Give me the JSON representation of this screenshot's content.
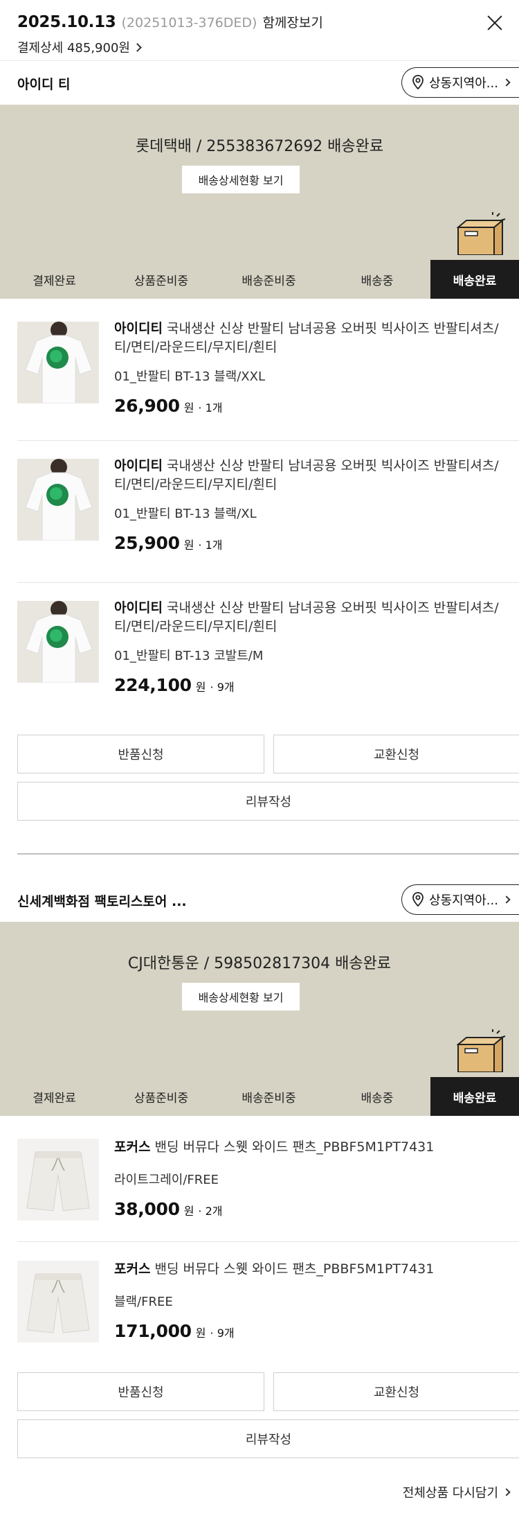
{
  "header": {
    "date": "2025.10.13",
    "order_code": "(20251013-376DED)",
    "together_link": "함께장보기",
    "payment_detail": "결제상세 485,900원"
  },
  "orders": [
    {
      "store": "아이디 티",
      "location_button": "상동지역아...",
      "carrier_status": "롯데택배 / 255383672692 배송완료",
      "tracking_button": "배송상세현황 보기",
      "steps": [
        "결제완료",
        "상품준비중",
        "배송준비중",
        "배송중",
        "배송완료"
      ],
      "active_step": "배송완료",
      "items": [
        {
          "brand": "아이디티",
          "name": " 국내생산 신상 반팔티 남녀공용 오버핏 빅사이즈 반팔티셔츠/티/면티/라운드티/무지티/흰티",
          "option": "01_반팔티 BT-13 블랙/XXL",
          "price": "26,900",
          "won": "원",
          "qty": "· 1개"
        },
        {
          "brand": "아이디티",
          "name": " 국내생산 신상 반팔티 남녀공용 오버핏 빅사이즈 반팔티셔츠/티/면티/라운드티/무지티/흰티",
          "option": "01_반팔티 BT-13 블랙/XL",
          "price": "25,900",
          "won": "원",
          "qty": "· 1개"
        },
        {
          "brand": "아이디티",
          "name": " 국내생산 신상 반팔티 남녀공용 오버핏 빅사이즈 반팔티셔츠/티/면티/라운드티/무지티/흰티",
          "option": "01_반팔티 BT-13 코발트/M",
          "price": "224,100",
          "won": "원",
          "qty": "· 9개"
        }
      ],
      "return_button": "반품신청",
      "exchange_button": "교환신청",
      "review_button": "리뷰작성"
    },
    {
      "store": "신세계백화점 팩토리스토어 ...",
      "location_button": "상동지역아...",
      "carrier_status": "CJ대한통운 / 598502817304 배송완료",
      "tracking_button": "배송상세현황 보기",
      "steps": [
        "결제완료",
        "상품준비중",
        "배송준비중",
        "배송중",
        "배송완료"
      ],
      "active_step": "배송완료",
      "items": [
        {
          "brand": "포커스",
          "name": " 밴딩 버뮤다 스웻 와이드 팬츠_PBBF5M1PT7431",
          "option": "라이트그레이/FREE",
          "price": "38,000",
          "won": "원",
          "qty": "· 2개"
        },
        {
          "brand": "포커스",
          "name": " 밴딩 버뮤다 스웻 와이드 팬츠_PBBF5M1PT7431",
          "option": "블랙/FREE",
          "price": "171,000",
          "won": "원",
          "qty": "· 9개"
        }
      ],
      "return_button": "반품신청",
      "exchange_button": "교환신청",
      "review_button": "리뷰작성"
    }
  ],
  "footer": {
    "reorder_all": "전체상품 다시담기"
  },
  "colors": {
    "banner_bg": "#d6d3c4",
    "active_step_bg": "#1c1c1c",
    "box_color": "#e3b978"
  }
}
